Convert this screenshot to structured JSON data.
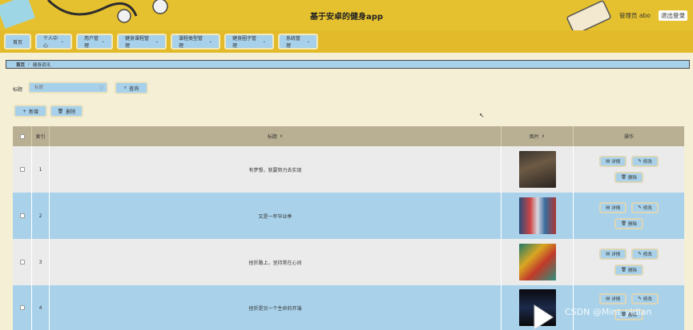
{
  "header": {
    "title": "基于安卓的健身app",
    "admin_text": "管理员 abo",
    "logout_label": "退出登录"
  },
  "nav": {
    "items": [
      {
        "label": "首页",
        "has_caret": false
      },
      {
        "label": "个人中心",
        "has_caret": true
      },
      {
        "label": "用户管理",
        "has_caret": true
      },
      {
        "label": "健身课程管理",
        "has_caret": true
      },
      {
        "label": "课程类型管理",
        "has_caret": true
      },
      {
        "label": "健身圈子管理",
        "has_caret": true
      },
      {
        "label": "系统管理",
        "has_caret": true
      }
    ],
    "caret": "⌄"
  },
  "breadcrumb": {
    "home": "首页",
    "separator": "/",
    "current": "健身资讯"
  },
  "search": {
    "label": "标题",
    "placeholder": "标题",
    "button_label": "查询"
  },
  "actions": {
    "add_label": "新增",
    "delete_label": "删除"
  },
  "table": {
    "columns": {
      "index": "索引",
      "title": "标题",
      "image": "图片",
      "ops": "操作"
    },
    "sort_glyph": "⇕",
    "rows": [
      {
        "index": "1",
        "title": "有梦想，就要努力去实现"
      },
      {
        "index": "2",
        "title": "又是一年毕业季"
      },
      {
        "index": "3",
        "title": "挫折路上，坚持常在心间"
      },
      {
        "index": "4",
        "title": "挫折是另一个生命的开端"
      }
    ],
    "row_actions": {
      "detail": "详情",
      "edit": "修改",
      "delete": "删除"
    }
  },
  "watermark": "CSDN @Mint_yidian",
  "colors": {
    "header_bg": "#e6c12f",
    "nav_bg": "#e3bb2a",
    "button_bg": "#a7d0ea",
    "row_odd": "#ebebeb",
    "row_even": "#a9d2ea",
    "thead_bg": "#b9b093"
  },
  "icons": {
    "search": "search-icon",
    "add": "plus-icon",
    "delete": "trash-icon",
    "detail": "document-icon",
    "edit": "pencil-icon"
  }
}
